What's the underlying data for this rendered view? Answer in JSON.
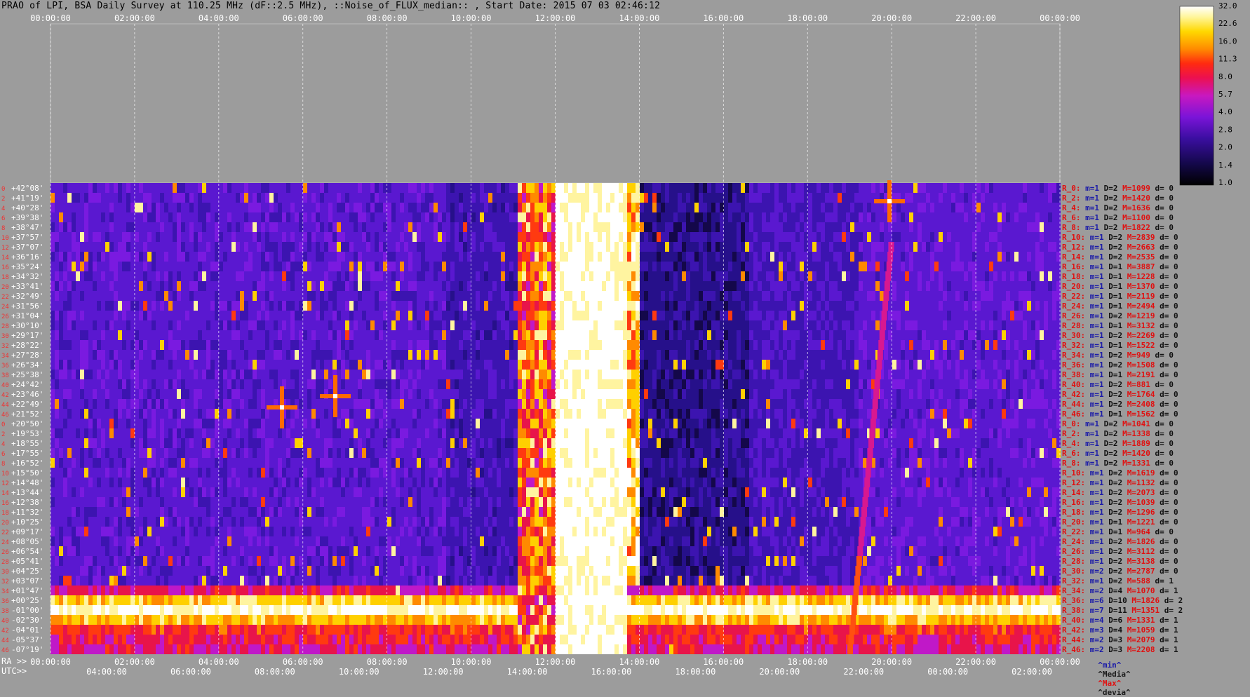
{
  "title": "PRAO of LPI, BSA Daily Survey at 110.25 MHz (dF::2.5 MHz), ::Noise_of_FLUX_median:: , Start Date: 2015 07 03 02:46:12",
  "footer": {
    "ra_label": "RA >>",
    "utc_label": "UTC>>",
    "legend": [
      {
        "text": "^min^",
        "color": "#1a1aa8"
      },
      {
        "text": "^Media^",
        "color": "#1a1a1a"
      },
      {
        "text": "^Max^",
        "color": "#e01010"
      },
      {
        "text": "^devia^",
        "color": "#1a1a1a"
      }
    ]
  },
  "colorscale": {
    "labels": [
      "32.0",
      "22.6",
      "16.0",
      "11.3",
      "8.0",
      "5.7",
      "4.0",
      "2.8",
      "2.0",
      "1.4",
      "1.0"
    ]
  },
  "chart_data": {
    "type": "heatmap",
    "title": "PRAO of LPI, BSA Daily Survey at 110.25 MHz (dF::2.5 MHz), ::Noise_of_FLUX_median:: , Start Date: 2015 07 03 02:46:12",
    "x_top_ticks": [
      "00:00:00",
      "02:00:00",
      "04:00:00",
      "06:00:00",
      "08:00:00",
      "10:00:00",
      "12:00:00",
      "14:00:00",
      "16:00:00",
      "18:00:00",
      "20:00:00",
      "22:00:00",
      "00:00:00"
    ],
    "x_ra_ticks": [
      "00:00:00",
      "02:00:00",
      "04:00:00",
      "06:00:00",
      "08:00:00",
      "10:00:00",
      "12:00:00",
      "14:00:00",
      "16:00:00",
      "18:00:00",
      "20:00:00",
      "22:00:00",
      "00:00:00"
    ],
    "x_utc_ticks": [
      "04:00:00",
      "06:00:00",
      "08:00:00",
      "10:00:00",
      "12:00:00",
      "14:00:00",
      "16:00:00",
      "18:00:00",
      "20:00:00",
      "22:00:00",
      "00:00:00",
      "02:00:00"
    ],
    "row_indices": [
      "0",
      "2",
      "4",
      "6",
      "8",
      "10",
      "12",
      "14",
      "16",
      "18",
      "20",
      "22",
      "24",
      "26",
      "28",
      "30",
      "32",
      "34",
      "36",
      "38",
      "40",
      "42",
      "44",
      "46",
      "0",
      "2",
      "4",
      "6",
      "8",
      "10",
      "12",
      "14",
      "16",
      "18",
      "20",
      "22",
      "24",
      "26",
      "28",
      "30",
      "32",
      "34",
      "36",
      "38",
      "40",
      "42",
      "44",
      "46"
    ],
    "declinations": [
      "+42°08'",
      "+41°19'",
      "+40°28'",
      "+39°38'",
      "+38°47'",
      "+37°57'",
      "+37°07'",
      "+36°16'",
      "+35°24'",
      "+34°32'",
      "+33°41'",
      "+32°49'",
      "+31°56'",
      "+31°04'",
      "+30°10'",
      "+29°17'",
      "+28°22'",
      "+27°28'",
      "+26°34'",
      "+25°38'",
      "+24°42'",
      "+23°46'",
      "+22°49'",
      "+21°52'",
      "+20°50'",
      "+19°53'",
      "+18°55'",
      "+17°55'",
      "+16°52'",
      "+15°50'",
      "+14°48'",
      "+13°44'",
      "+12°38'",
      "+11°32'",
      "+10°25'",
      "+09°17'",
      "+08°05'",
      "+06°54'",
      "+05°41'",
      "+04°25'",
      "+03°07'",
      "+01°47'",
      "+00°25'",
      "-01°00'",
      "-02°30'",
      "-04°01'",
      "-05°37'",
      "-07°19'"
    ],
    "row_stats": [
      {
        "r": "R_0:",
        "m": "m=1",
        "D": "D=2",
        "M": "M=1099",
        "d": "d= 0"
      },
      {
        "r": "R_2:",
        "m": "m=1",
        "D": "D=2",
        "M": "M=1420",
        "d": "d= 0"
      },
      {
        "r": "R_4:",
        "m": "m=1",
        "D": "D=2",
        "M": "M=1636",
        "d": "d= 0"
      },
      {
        "r": "R_6:",
        "m": "m=1",
        "D": "D=2",
        "M": "M=1100",
        "d": "d= 0"
      },
      {
        "r": "R_8:",
        "m": "m=1",
        "D": "D=2",
        "M": "M=1822",
        "d": "d= 0"
      },
      {
        "r": "R_10:",
        "m": "m=1",
        "D": "D=2",
        "M": "M=2839",
        "d": "d= 0"
      },
      {
        "r": "R_12:",
        "m": "m=1",
        "D": "D=2",
        "M": "M=2663",
        "d": "d= 0"
      },
      {
        "r": "R_14:",
        "m": "m=1",
        "D": "D=2",
        "M": "M=2535",
        "d": "d= 0"
      },
      {
        "r": "R_16:",
        "m": "m=1",
        "D": "D=1",
        "M": "M=3887",
        "d": "d= 0"
      },
      {
        "r": "R_18:",
        "m": "m=1",
        "D": "D=1",
        "M": "M=1228",
        "d": "d= 0"
      },
      {
        "r": "R_20:",
        "m": "m=1",
        "D": "D=1",
        "M": "M=1370",
        "d": "d= 0"
      },
      {
        "r": "R_22:",
        "m": "m=1",
        "D": "D=1",
        "M": "M=2119",
        "d": "d= 0"
      },
      {
        "r": "R_24:",
        "m": "m=1",
        "D": "D=1",
        "M": "M=2494",
        "d": "d= 0"
      },
      {
        "r": "R_26:",
        "m": "m=1",
        "D": "D=2",
        "M": "M=1219",
        "d": "d= 0"
      },
      {
        "r": "R_28:",
        "m": "m=1",
        "D": "D=1",
        "M": "M=3132",
        "d": "d= 0"
      },
      {
        "r": "R_30:",
        "m": "m=1",
        "D": "D=2",
        "M": "M=2269",
        "d": "d= 0"
      },
      {
        "r": "R_32:",
        "m": "m=1",
        "D": "D=1",
        "M": "M=1522",
        "d": "d= 0"
      },
      {
        "r": "R_34:",
        "m": "m=1",
        "D": "D=2",
        "M": "M=949",
        "d": "d= 0"
      },
      {
        "r": "R_36:",
        "m": "m=1",
        "D": "D=2",
        "M": "M=1508",
        "d": "d= 0"
      },
      {
        "r": "R_38:",
        "m": "m=1",
        "D": "D=1",
        "M": "M=2191",
        "d": "d= 0"
      },
      {
        "r": "R_40:",
        "m": "m=1",
        "D": "D=2",
        "M": "M=881",
        "d": "d= 0"
      },
      {
        "r": "R_42:",
        "m": "m=1",
        "D": "D=2",
        "M": "M=1764",
        "d": "d= 0"
      },
      {
        "r": "R_44:",
        "m": "m=1",
        "D": "D=2",
        "M": "M=2408",
        "d": "d= 0"
      },
      {
        "r": "R_46:",
        "m": "m=1",
        "D": "D=1",
        "M": "M=1562",
        "d": "d= 0"
      },
      {
        "r": "R_0:",
        "m": "m=1",
        "D": "D=2",
        "M": "M=1041",
        "d": "d= 0"
      },
      {
        "r": "R_2:",
        "m": "m=1",
        "D": "D=2",
        "M": "M=1338",
        "d": "d= 0"
      },
      {
        "r": "R_4:",
        "m": "m=1",
        "D": "D=2",
        "M": "M=1889",
        "d": "d= 0"
      },
      {
        "r": "R_6:",
        "m": "m=1",
        "D": "D=2",
        "M": "M=1420",
        "d": "d= 0"
      },
      {
        "r": "R_8:",
        "m": "m=1",
        "D": "D=2",
        "M": "M=1331",
        "d": "d= 0"
      },
      {
        "r": "R_10:",
        "m": "m=1",
        "D": "D=2",
        "M": "M=1619",
        "d": "d= 0"
      },
      {
        "r": "R_12:",
        "m": "m=1",
        "D": "D=2",
        "M": "M=1132",
        "d": "d= 0"
      },
      {
        "r": "R_14:",
        "m": "m=1",
        "D": "D=2",
        "M": "M=2073",
        "d": "d= 0"
      },
      {
        "r": "R_16:",
        "m": "m=1",
        "D": "D=2",
        "M": "M=1039",
        "d": "d= 0"
      },
      {
        "r": "R_18:",
        "m": "m=1",
        "D": "D=2",
        "M": "M=1296",
        "d": "d= 0"
      },
      {
        "r": "R_20:",
        "m": "m=1",
        "D": "D=1",
        "M": "M=1221",
        "d": "d= 0"
      },
      {
        "r": "R_22:",
        "m": "m=1",
        "D": "D=1",
        "M": "M=964",
        "d": "d= 0"
      },
      {
        "r": "R_24:",
        "m": "m=1",
        "D": "D=2",
        "M": "M=1826",
        "d": "d= 0"
      },
      {
        "r": "R_26:",
        "m": "m=1",
        "D": "D=2",
        "M": "M=3112",
        "d": "d= 0"
      },
      {
        "r": "R_28:",
        "m": "m=1",
        "D": "D=2",
        "M": "M=3138",
        "d": "d= 0"
      },
      {
        "r": "R_30:",
        "m": "m=2",
        "D": "D=2",
        "M": "M=2787",
        "d": "d= 0"
      },
      {
        "r": "R_32:",
        "m": "m=1",
        "D": "D=2",
        "M": "M=588",
        "d": "d= 1"
      },
      {
        "r": "R_34:",
        "m": "m=2",
        "D": "D=4",
        "M": "M=1070",
        "d": "d= 1"
      },
      {
        "r": "R_36:",
        "m": "m=6",
        "D": "D=10",
        "M": "M=1826",
        "d": "d= 2"
      },
      {
        "r": "R_38:",
        "m": "m=7",
        "D": "D=11",
        "M": "M=1351",
        "d": "d= 2"
      },
      {
        "r": "R_40:",
        "m": "m=4",
        "D": "D=6",
        "M": "M=1331",
        "d": "d= 1"
      },
      {
        "r": "R_42:",
        "m": "m=3",
        "D": "D=4",
        "M": "M=1059",
        "d": "d= 1"
      },
      {
        "r": "R_44:",
        "m": "m=2",
        "D": "D=3",
        "M": "M=2079",
        "d": "d= 1"
      },
      {
        "r": "R_46:",
        "m": "m=2",
        "D": "D=3",
        "M": "M=2208",
        "d": "d= 1"
      }
    ],
    "colors": {
      "background": "#9c9c9c",
      "index_label": "#e33333",
      "stat_r": "#e01010",
      "stat_m": "#1a1aa8",
      "stat_D": "#111111",
      "stat_M": "#e01010",
      "stat_d": "#111111"
    }
  }
}
